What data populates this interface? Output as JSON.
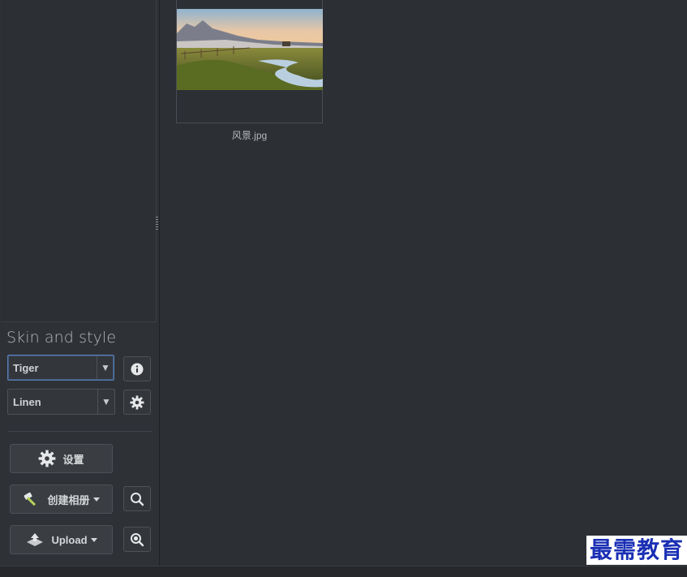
{
  "skin_panel": {
    "title": "Skin and style",
    "skin_select": "Tiger",
    "style_select": "Linen"
  },
  "buttons": {
    "settings": "设置",
    "create_album": "创建相册",
    "upload": "Upload"
  },
  "gallery": {
    "items": [
      {
        "caption": "风景.jpg"
      }
    ]
  },
  "watermark": "最需教育",
  "icons": {
    "info": "info-icon",
    "gear": "gear-icon",
    "hammer": "hammer-icon",
    "upload": "upload-icon",
    "search": "search-icon",
    "zoom": "zoom-icon"
  },
  "colors": {
    "background": "#2c2f33",
    "focus_border": "#5c7fb0",
    "watermark": "#1a2fb4"
  }
}
